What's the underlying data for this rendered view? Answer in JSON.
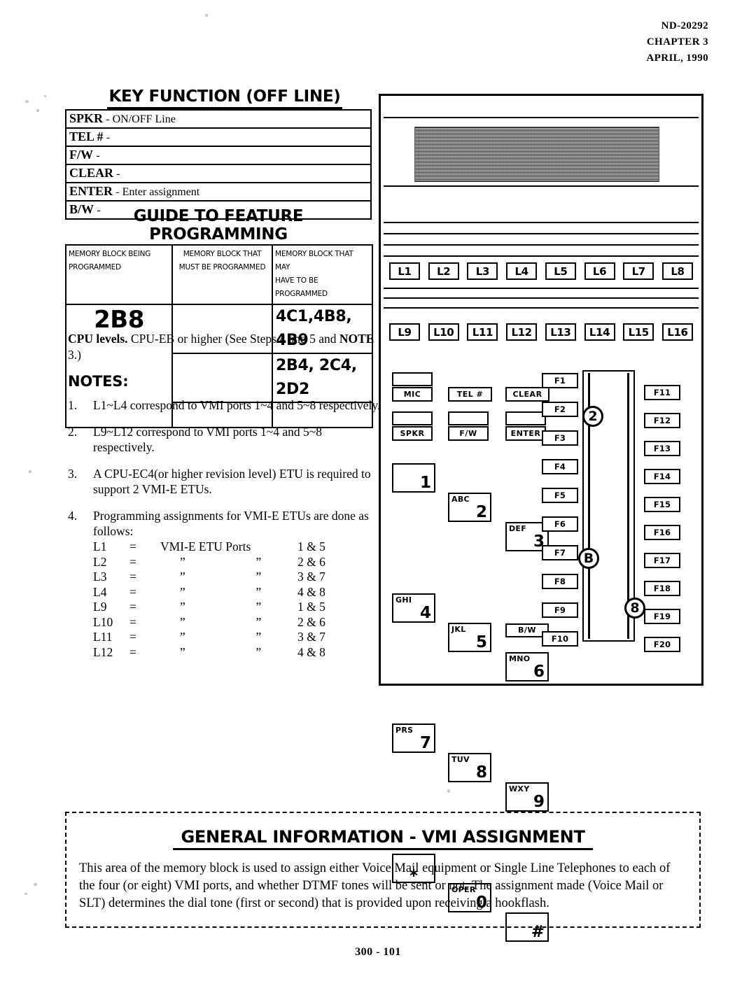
{
  "doc_header": {
    "document_number": "ND-20292",
    "chapter": "CHAPTER 3",
    "date": "APRIL, 1990"
  },
  "key_function": {
    "title": "KEY FUNCTION (OFF LINE)",
    "rows": [
      {
        "key": "SPKR",
        "desc": "- ON/OFF Line"
      },
      {
        "key": "TEL #",
        "desc": "-"
      },
      {
        "key": "F/W",
        "desc": "-"
      },
      {
        "key": "CLEAR",
        "desc": "-"
      },
      {
        "key": "ENTER",
        "desc": "- Enter assignment"
      },
      {
        "key": "B/W",
        "desc": "-"
      }
    ]
  },
  "guide": {
    "title": "GUIDE TO FEATURE PROGRAMMING",
    "headers": {
      "col1_line1": "MEMORY BLOCK BEING",
      "col1_line2": "PROGRAMMED",
      "col2_line1": "MEMORY BLOCK THAT",
      "col2_line2": "MUST BE PROGRAMMED",
      "col3_line1": "MEMORY BLOCK THAT MAY",
      "col3_line2": "HAVE TO BE PROGRAMMED"
    },
    "memory_block": "2B8",
    "must_be_programmed": [
      "",
      "",
      ""
    ],
    "may_have_to_be_programmed": [
      "4C1,4B8, 4B9",
      "2B4, 2C4, 2D2",
      ""
    ]
  },
  "cpu_levels": {
    "label": "CPU levels.",
    "text_part1": "  CPU-EB or higher (See Steps 4 and 5 and ",
    "note_word": "NOTE",
    "text_part2": " 3.)"
  },
  "notes": {
    "heading": "NOTES:",
    "items": [
      {
        "num": "1.",
        "text": "L1~L4 correspond to VMI ports 1~4 and 5~8 respectively."
      },
      {
        "num": "2.",
        "text": "L9~L12 correspond to VMI ports 1~4 and 5~8 respectively."
      },
      {
        "num": "3.",
        "text": "A CPU-EC4(or higher revision level) ETU is required to support 2 VMI-E ETUs."
      },
      {
        "num": "4.",
        "text": "Programming assignments for VMI-E ETUs are done as follows:"
      }
    ],
    "assignments": {
      "equals": "=",
      "ditto": "”",
      "first_mid": "VMI-E ETU Ports",
      "rows": [
        {
          "line": "L1",
          "mid": "VMI-E ETU Ports",
          "mid2": "",
          "ports": "1 & 5"
        },
        {
          "line": "L2",
          "mid": "”",
          "mid2": "”",
          "ports": "2 & 6"
        },
        {
          "line": "L3",
          "mid": "”",
          "mid2": "”",
          "ports": "3 & 7"
        },
        {
          "line": "L4",
          "mid": "”",
          "mid2": "”",
          "ports": "4 & 8"
        },
        {
          "line": "L9",
          "mid": "”",
          "mid2": "”",
          "ports": "1 & 5"
        },
        {
          "line": "L10",
          "mid": "”",
          "mid2": "”",
          "ports": "2 & 6"
        },
        {
          "line": "L11",
          "mid": "”",
          "mid2": "”",
          "ports": "3 & 7"
        },
        {
          "line": "L12",
          "mid": "”",
          "mid2": "”",
          "ports": "4 & 8"
        }
      ]
    }
  },
  "phone": {
    "line_keys_top": [
      "L1",
      "L2",
      "L3",
      "L4",
      "L5",
      "L6",
      "L7",
      "L8"
    ],
    "line_keys_bottom": [
      "L9",
      "L10",
      "L11",
      "L12",
      "L13",
      "L14",
      "L15",
      "L16"
    ],
    "function_keys_left": [
      "F1",
      "F2",
      "F3",
      "F4",
      "F5",
      "F6",
      "F7",
      "F8",
      "F9",
      "F10"
    ],
    "function_keys_right": [
      "F11",
      "F12",
      "F13",
      "F14",
      "F15",
      "F16",
      "F17",
      "F18",
      "F19",
      "F20"
    ],
    "feature_keys": {
      "mic": "MIC",
      "tel_hash": "TEL #",
      "clear": "CLEAR",
      "spkr": "SPKR",
      "fw": "F/W",
      "enter": "ENTER",
      "bw": "B/W"
    },
    "keypad": [
      {
        "alpha": "",
        "digit": "1"
      },
      {
        "alpha": "ABC",
        "digit": "2"
      },
      {
        "alpha": "DEF",
        "digit": "3"
      },
      {
        "alpha": "GHI",
        "digit": "4"
      },
      {
        "alpha": "JKL",
        "digit": "5"
      },
      {
        "alpha": "MNO",
        "digit": "6"
      },
      {
        "alpha": "PRS",
        "digit": "7"
      },
      {
        "alpha": "TUV",
        "digit": "8"
      },
      {
        "alpha": "WXY",
        "digit": "9"
      },
      {
        "alpha": "",
        "digit": "∗"
      },
      {
        "alpha": "OPER",
        "digit": "0"
      },
      {
        "alpha": "",
        "digit": "#"
      }
    ],
    "callouts": [
      "2",
      "B",
      "8"
    ]
  },
  "general_information": {
    "title": "GENERAL INFORMATION  -  VMI ASSIGNMENT",
    "body": "This area of the memory block is used to assign either Voice Mail equipment or Single Line Telephones to each of the four (or eight) VMI ports, and whether DTMF tones will be sent or not.  The assignment made (Voice Mail or SLT) determines the dial tone (first or second) that is provided upon receiving a hookflash."
  },
  "footer": {
    "page_number": "300 - 101"
  }
}
